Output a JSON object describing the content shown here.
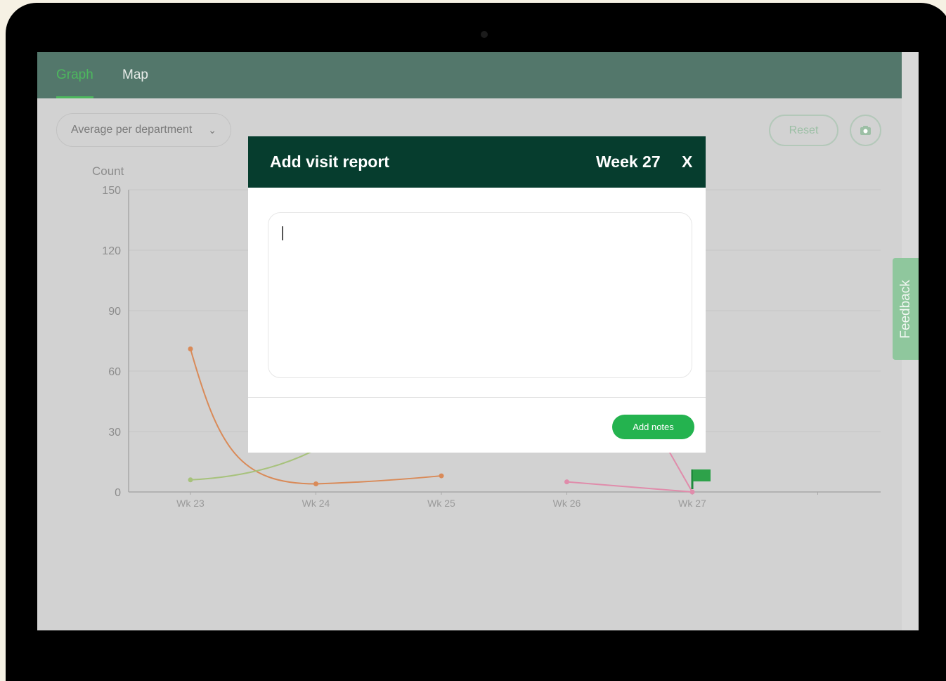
{
  "tabs": [
    {
      "label": "Graph",
      "active": true
    },
    {
      "label": "Map",
      "active": false
    }
  ],
  "filter": {
    "selected": "Average per department",
    "chevron_icon": "chevron-down-icon"
  },
  "toolbar": {
    "reset_label": "Reset",
    "camera_icon": "camera-icon"
  },
  "feedback_label": "Feedback",
  "colors": {
    "topbar": "#53776b",
    "accent_green": "#4db85e",
    "modal_header": "#063d2e",
    "primary_button": "#24b34f",
    "series_orange": "#d98a58",
    "series_lightgreen": "#a7c27c",
    "series_pink": "#e08cab"
  },
  "chart_data": {
    "type": "line",
    "ylabel": "Count",
    "ylim": [
      0,
      150
    ],
    "yticks": [
      "0",
      "30",
      "60",
      "90",
      "120",
      "150"
    ],
    "categories": [
      "Wk 23",
      "Wk 24",
      "Wk 25",
      "Wk 26",
      "Wk 27"
    ],
    "grid": true,
    "series": [
      {
        "color": "#d98a58",
        "values": [
          71,
          4,
          8,
          null,
          null
        ]
      },
      {
        "color": "#a7c27c",
        "values": [
          6,
          null,
          null,
          null,
          null
        ]
      },
      {
        "color": "#e08cab",
        "values": [
          null,
          null,
          null,
          5,
          0
        ]
      }
    ],
    "flag_at": "Wk 27"
  },
  "modal": {
    "title": "Add visit report",
    "week": "Week 27",
    "close": "X",
    "textarea_value": "",
    "submit_label": "Add notes"
  }
}
